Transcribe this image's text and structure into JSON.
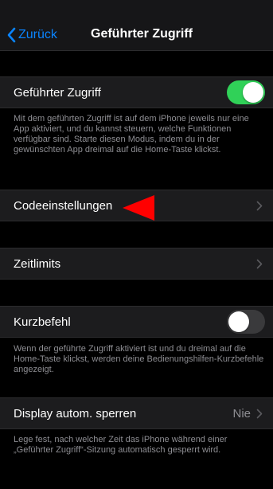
{
  "navbar": {
    "back_label": "Zurück",
    "title": "Geführter Zugriff"
  },
  "main_switch": {
    "label": "Geführter Zugriff",
    "state": "on",
    "description": "Mit dem geführten Zugriff ist auf dem iPhone jeweils nur eine App aktiviert, und du kannst steuern, welche Funktionen verfügbar sind. Starte diesen Modus, indem du in der gewünschten App dreimal auf die Home-Taste klickst."
  },
  "passcode_settings": {
    "label": "Codeeinstellungen"
  },
  "time_limits": {
    "label": "Zeitlimits"
  },
  "shortcut": {
    "label": "Kurzbefehl",
    "state": "off",
    "description": "Wenn der geführte Zugriff aktiviert ist und du dreimal auf die Home-Taste klickst, werden deine Bedienungshilfen-Kurzbefehle angezeigt."
  },
  "auto_lock": {
    "label": "Display autom. sperren",
    "value": "Nie",
    "description": "Lege fest, nach welcher Zeit das iPhone während einer „Geführter Zugriff“-Sitzung automatisch gesperrt wird."
  },
  "colors": {
    "accent": "#0a84ff",
    "toggle_on": "#30d158",
    "annotation_arrow": "#ff0000"
  },
  "icons": [
    "chevron-left-icon",
    "chevron-right-icon",
    "red-arrow-marker"
  ]
}
